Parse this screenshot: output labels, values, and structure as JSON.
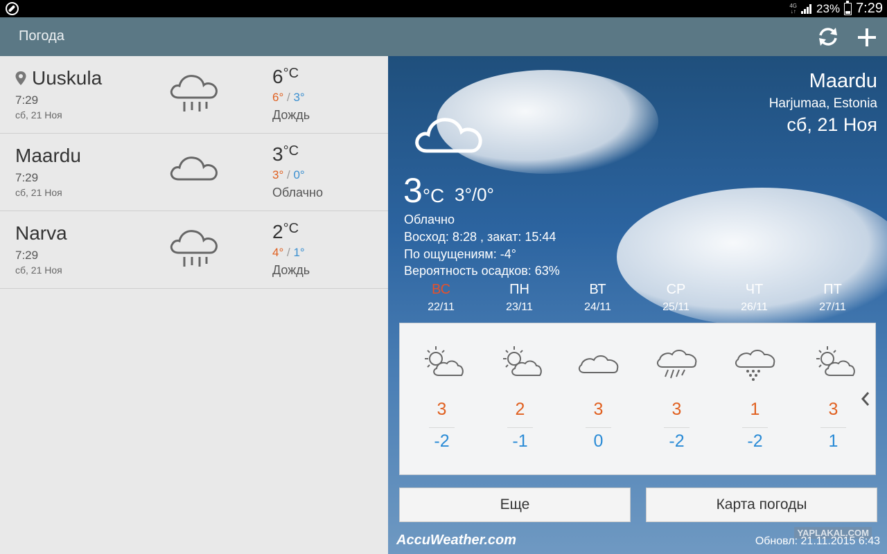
{
  "status_bar": {
    "network": "4G",
    "battery": "23%",
    "time": "7:29"
  },
  "app_bar": {
    "title": "Погода"
  },
  "cities": [
    {
      "name": "Uuskula",
      "time": "7:29",
      "date": "сб, 21 Ноя",
      "temp": "6",
      "unit": "°C",
      "hi": "6°",
      "sep": "/",
      "lo": "3°",
      "condition": "Дождь",
      "icon": "rain-cloud-icon",
      "current_location": true
    },
    {
      "name": "Maardu",
      "time": "7:29",
      "date": "сб, 21 Ноя",
      "temp": "3",
      "unit": "°C",
      "hi": "3°",
      "sep": "/",
      "lo": "0°",
      "condition": "Облачно",
      "icon": "cloud-icon",
      "current_location": false
    },
    {
      "name": "Narva",
      "time": "7:29",
      "date": "сб, 21 Ноя",
      "temp": "2",
      "unit": "°C",
      "hi": "4°",
      "sep": "/",
      "lo": "1°",
      "condition": "Дождь",
      "icon": "rain-cloud-icon",
      "current_location": false
    }
  ],
  "detail": {
    "city": "Maardu",
    "region": "Harjumaa, Estonia",
    "date": "сб, 21 Ноя",
    "temp": "3",
    "unit": "°C",
    "hilo": "3°/0°",
    "condition": "Облачно",
    "sun": "Восход: 8:28 , закат: 15:44",
    "feels": "По ощущениям: -4°",
    "precip": "Вероятность осадков: 63%",
    "icon": "cloud-icon"
  },
  "forecast": [
    {
      "day": "ВС",
      "date": "22/11",
      "hi": "3",
      "lo": "-2",
      "icon": "partly-sunny-icon",
      "highlight": true
    },
    {
      "day": "ПН",
      "date": "23/11",
      "hi": "2",
      "lo": "-1",
      "icon": "partly-sunny-icon",
      "highlight": false
    },
    {
      "day": "ВТ",
      "date": "24/11",
      "hi": "3",
      "lo": "0",
      "icon": "cloud-icon",
      "highlight": false
    },
    {
      "day": "СР",
      "date": "25/11",
      "hi": "3",
      "lo": "-2",
      "icon": "rain-cloud-icon",
      "highlight": false
    },
    {
      "day": "ЧТ",
      "date": "26/11",
      "hi": "1",
      "lo": "-2",
      "icon": "snow-cloud-icon",
      "highlight": false
    },
    {
      "day": "ПТ",
      "date": "27/11",
      "hi": "3",
      "lo": "1",
      "icon": "partly-sunny-icon",
      "highlight": false
    }
  ],
  "buttons": {
    "more": "Еще",
    "map": "Карта погоды"
  },
  "footer": {
    "brand": "AccuWeather.com",
    "updated": "Обновл: 21.11.2015 6:43",
    "watermark": "YAPLAKAL.COM"
  },
  "colors": {
    "app_bar": "#5b7885",
    "high": "#e06020",
    "low": "#2a8bd6",
    "sunday": "#e8502a"
  }
}
